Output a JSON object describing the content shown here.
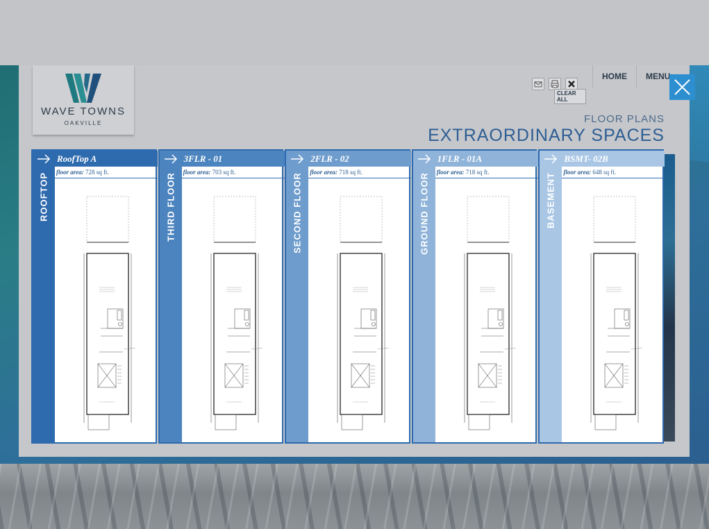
{
  "logo": {
    "name": "WAVE TOWNS",
    "subtitle": "OAKVILLE"
  },
  "nav": {
    "home": "HOME",
    "menu": "MENU"
  },
  "toolbar": {
    "clear_all": "CLEAR ALL"
  },
  "heading": {
    "subtitle": "FLOOR PLANS",
    "title": "EXTRAORDINARY SPACES"
  },
  "colors": {
    "accent": "#2d6aae",
    "close": "#2d8fd0",
    "title": "#2d5e93"
  },
  "cards": [
    {
      "code": "RoofTop A",
      "floor": "ROOFTOP",
      "area_label": "floor area:",
      "area_value": "728 sq ft.",
      "color": "#2e6aae"
    },
    {
      "code": "3FLR - 01",
      "floor": "THIRD FLOOR",
      "area_label": "floor area:",
      "area_value": "703 sq ft.",
      "color": "#4c84bf"
    },
    {
      "code": "2FLR - 02",
      "floor": "SECOND FLOOR",
      "area_label": "floor area:",
      "area_value": "718 sq ft.",
      "color": "#6e9ccc"
    },
    {
      "code": "1FLR - 01A",
      "floor": "GROUND FLOOR",
      "area_label": "floor area:",
      "area_value": "718 sq ft.",
      "color": "#8fb3d9"
    },
    {
      "code": "BSMT- 02B",
      "floor": "BASEMENT",
      "area_label": "floor area:",
      "area_value": "648 sq ft.",
      "color": "#a9c6e5"
    }
  ]
}
